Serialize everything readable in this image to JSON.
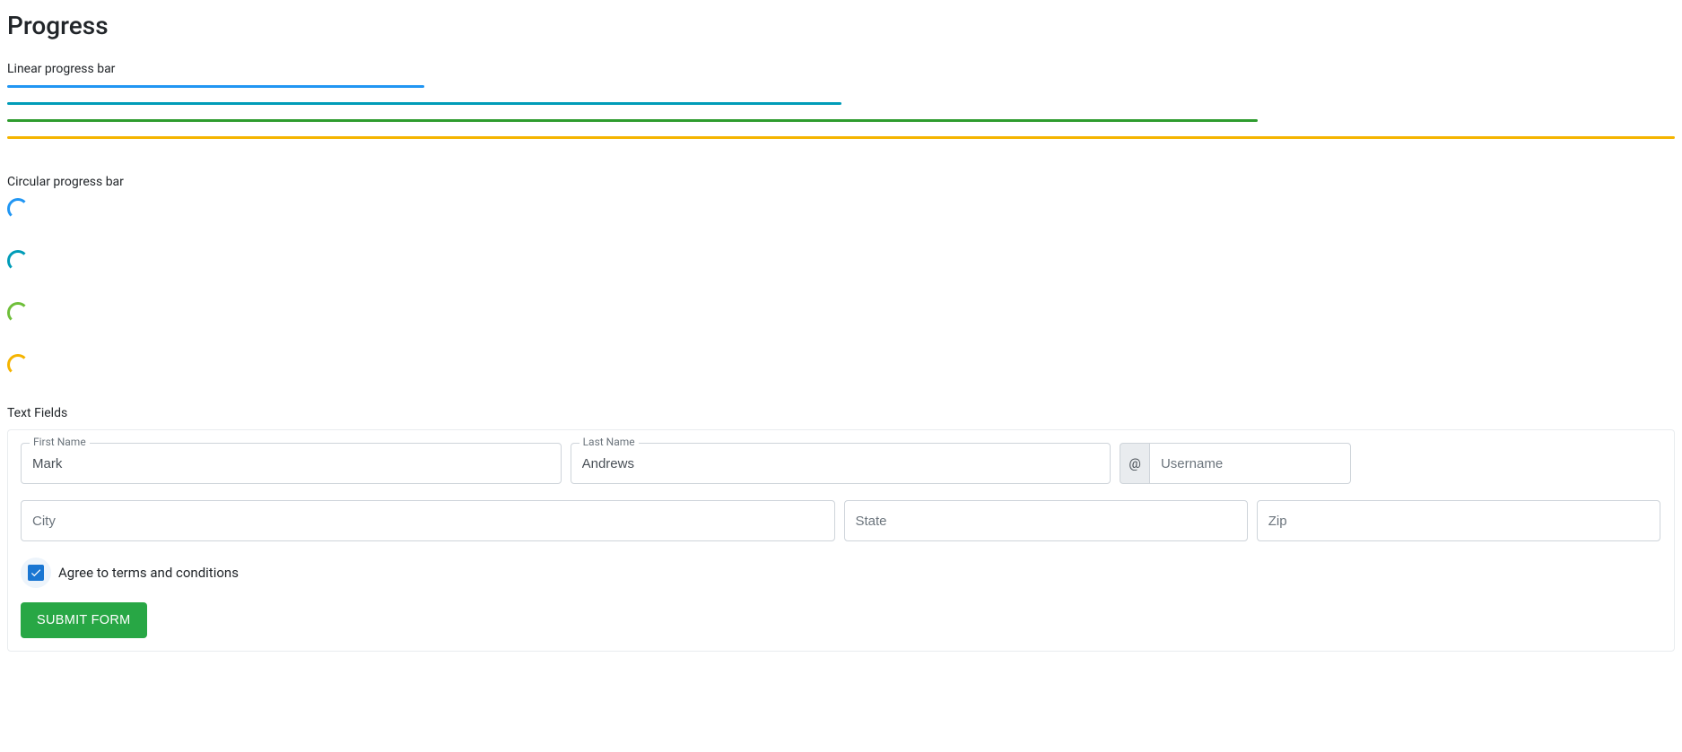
{
  "progress": {
    "title": "Progress",
    "linear_label": "Linear progress bar",
    "circular_label": "Circular progress bar",
    "linear_bars": [
      {
        "percent": 25,
        "color": "#2196f3"
      },
      {
        "percent": 50,
        "color": "#009cb8"
      },
      {
        "percent": 75,
        "color": "#2e9c2e"
      },
      {
        "percent": 100,
        "color": "#f5b400"
      }
    ],
    "circular_spinners": [
      {
        "color": "#2196f3"
      },
      {
        "color": "#009cb8"
      },
      {
        "color": "#6fbf3a"
      },
      {
        "color": "#f5b400"
      }
    ]
  },
  "form": {
    "section_label": "Text Fields",
    "first_name": {
      "label": "First Name",
      "value": "Mark"
    },
    "last_name": {
      "label": "Last Name",
      "value": "Andrews"
    },
    "username": {
      "prefix": "@",
      "placeholder": "Username",
      "value": ""
    },
    "city": {
      "placeholder": "City",
      "value": ""
    },
    "state": {
      "placeholder": "State",
      "value": ""
    },
    "zip": {
      "placeholder": "Zip",
      "value": ""
    },
    "terms": {
      "label": "Agree to terms and conditions",
      "checked": true
    },
    "submit_label": "Submit form"
  }
}
